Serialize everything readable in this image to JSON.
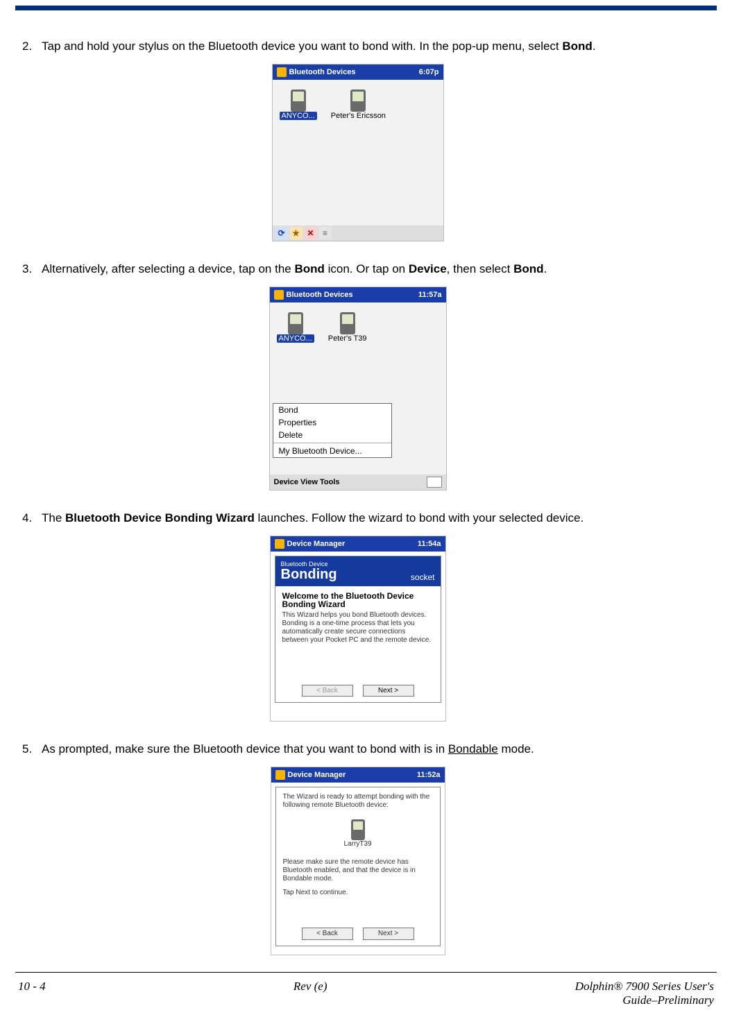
{
  "steps": {
    "s2": {
      "num": "2.",
      "t1": "Tap and hold your stylus on the Bluetooth device you want to bond with. In the pop-up menu, select ",
      "b1": "Bond",
      "t2": "."
    },
    "s3": {
      "num": "3.",
      "t1": "Alternatively, after selecting a device, tap on the ",
      "b1": "Bond",
      "t2": " icon. Or tap on ",
      "b2": "Device",
      "t3": ", then select ",
      "b3": "Bond",
      "t4": "."
    },
    "s4": {
      "num": "4.",
      "t1": "The ",
      "b1": "Bluetooth Device Bonding Wizard",
      "t2": " launches. Follow the wizard to bond with your selected device."
    },
    "s5": {
      "num": "5.",
      "t1": "As prompted, make sure the Bluetooth device that you want to bond with is in ",
      "u1": "Bondable",
      "t2": " mode."
    }
  },
  "img1": {
    "title": "Bluetooth Devices",
    "time": "6:07p",
    "dev1": "ANYCO...",
    "dev2": "Peter's Ericsson"
  },
  "img2": {
    "title": "Bluetooth Devices",
    "time": "11:57a",
    "dev1": "ANYCO...",
    "dev2": "Peter's T39",
    "menu": {
      "bond": "Bond",
      "prop": "Properties",
      "del": "Delete",
      "my": "My Bluetooth Device..."
    },
    "menubar": "Device  View  Tools"
  },
  "img3": {
    "title": "Device Manager",
    "time": "11:54a",
    "headSmall": "Bluetooth Device",
    "headBig": "Bonding",
    "brand": "socket",
    "h": "Welcome to the Bluetooth Device Bonding Wizard",
    "body": "This Wizard helps you bond Bluetooth devices. Bonding is a one-time process that lets you automatically create secure connections between your Pocket PC and the remote device.",
    "back": "< Back",
    "next": "Next >"
  },
  "img4": {
    "title": "Device Manager",
    "time": "11:52a",
    "head": "The Wizard is ready to attempt bonding with the following remote Bluetooth device:",
    "dev": "LarryT39",
    "body": "Please make sure the remote device has Bluetooth enabled, and that the device is in Bondable mode.",
    "cont": "Tap Next to continue.",
    "back": "< Back",
    "next": "Next >"
  },
  "footer": {
    "left": "10 - 4",
    "center": "Rev (e)",
    "rightA": "Dolphin® 7900 Series User's",
    "rightB": "Guide–Preliminary"
  }
}
